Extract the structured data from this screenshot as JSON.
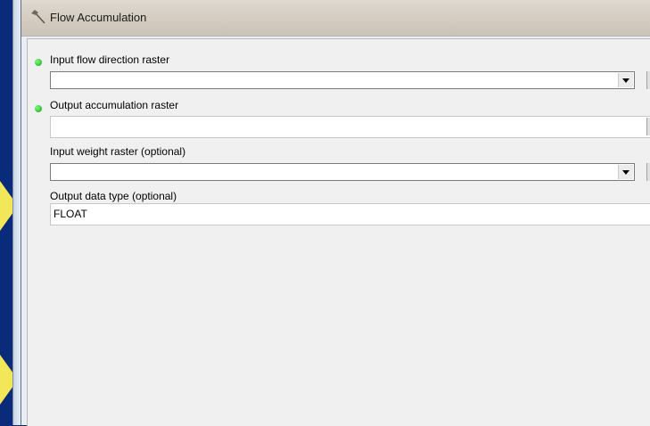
{
  "window": {
    "title": "Flow Accumulation",
    "title_icon": "hammer-icon"
  },
  "fields": {
    "input_flow_direction": {
      "label": "Input flow direction raster",
      "value": "",
      "required": true
    },
    "output_accumulation": {
      "label": "Output accumulation raster",
      "value": "",
      "required": true
    },
    "input_weight": {
      "label": "Input weight raster (optional)",
      "value": ""
    },
    "output_data_type": {
      "label": "Output data type (optional)",
      "value": "FLOAT"
    }
  },
  "colors": {
    "background": "#0a2a7a",
    "callout": "#f2e659",
    "required_dot": "#14a014"
  }
}
